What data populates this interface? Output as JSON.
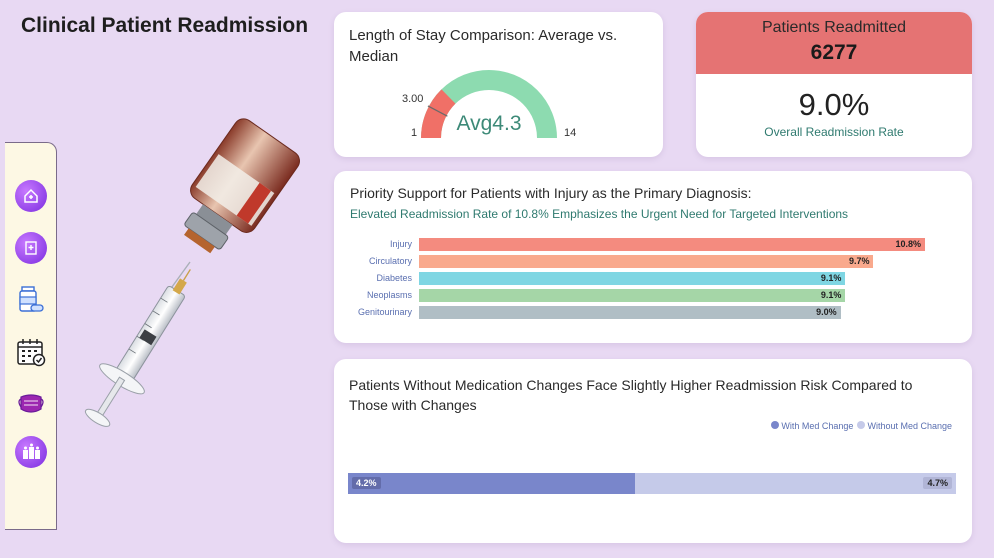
{
  "page": {
    "title": "Clinical Patient Readmission"
  },
  "sidebar": {
    "icons": [
      "hospital-icon",
      "medical-chart-icon",
      "medication-icon",
      "calendar-icon",
      "face-mask-icon",
      "patient-bottles-icon"
    ]
  },
  "gauge": {
    "title": "Length of Stay Comparison: Average vs. Median",
    "center_label": "Avg4.3",
    "min_label": "1",
    "max_label": "14",
    "median_label": "3.00",
    "min": 1,
    "max": 14,
    "average": 4.3,
    "median": 3.0,
    "colors": {
      "fill": "#f07067",
      "track": "#8ddbb0"
    }
  },
  "kpi": {
    "header_label": "Patients Readmitted",
    "header_value": "6277",
    "rate_value": "9.0%",
    "rate_label": "Overall Readmission Rate",
    "header_color": "#e57373"
  },
  "diagnosis": {
    "title": "Priority Support for Patients with Injury as the Primary Diagnosis:",
    "subtitle": "Elevated Readmission Rate of 10.8% Emphasizes the Urgent Need for Targeted Interventions",
    "rows": [
      {
        "label": "Injury",
        "value": 10.8,
        "value_label": "10.8%",
        "color": "#f48b7f"
      },
      {
        "label": "Circulatory",
        "value": 9.7,
        "value_label": "9.7%",
        "color": "#f9a98d"
      },
      {
        "label": "Diabetes",
        "value": 9.1,
        "value_label": "9.1%",
        "color": "#7fd6e3"
      },
      {
        "label": "Neoplasms",
        "value": 9.1,
        "value_label": "9.1%",
        "color": "#a5d6a7"
      },
      {
        "label": "Genitourinary",
        "value": 9.0,
        "value_label": "9.0%",
        "color": "#b0bec5"
      }
    ],
    "max": 10.8
  },
  "medication": {
    "title": "Patients Without Medication Changes Face Slightly Higher Readmission Risk Compared to Those with Changes",
    "legend": [
      {
        "label": "With Med Change",
        "color": "#7986cb"
      },
      {
        "label": "Without Med Change",
        "color": "#c5cae9"
      }
    ],
    "segments": [
      {
        "label": "4.2%",
        "value": 4.2,
        "color": "#7986cb"
      },
      {
        "label": "4.7%",
        "value": 4.7,
        "color": "#c5cae9"
      }
    ]
  }
}
